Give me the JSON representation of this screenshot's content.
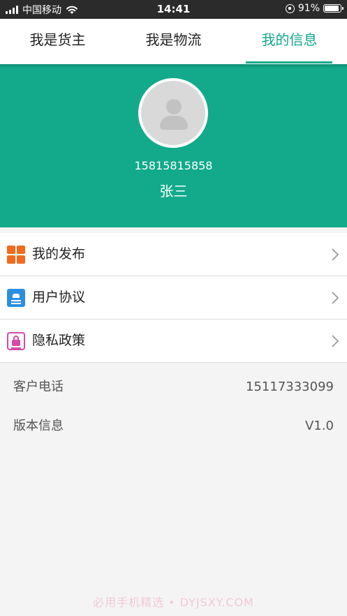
{
  "status_bar": {
    "carrier": "中国移动",
    "time": "14:41",
    "battery": "91%",
    "battery_level": 0.91,
    "icons": [
      "signal-icon",
      "wifi-icon",
      "rotation-lock-icon",
      "battery-icon"
    ]
  },
  "tabs": [
    {
      "label": "我是货主",
      "active": false
    },
    {
      "label": "我是物流",
      "active": false
    },
    {
      "label": "我的信息",
      "active": true
    }
  ],
  "profile": {
    "phone": "15815815858",
    "name": "张三",
    "avatar_icon": "default-avatar-icon"
  },
  "menu": [
    {
      "label": "我的发布",
      "icon": "grid-icon",
      "color": "#f36a1e"
    },
    {
      "label": "用户协议",
      "icon": "document-icon",
      "color": "#2b8fe0"
    },
    {
      "label": "隐私政策",
      "icon": "lock-icon",
      "color": "#d64aa6"
    }
  ],
  "info": [
    {
      "key": "客户电话",
      "value": "15117333099"
    },
    {
      "key": "版本信息",
      "value": "V1.0"
    }
  ],
  "watermark": "必用手机精选 • DYJSXY.COM",
  "colors": {
    "accent": "#13a88a",
    "profile_bg": "#12aa8b",
    "page_bg": "#f4f4f4"
  }
}
